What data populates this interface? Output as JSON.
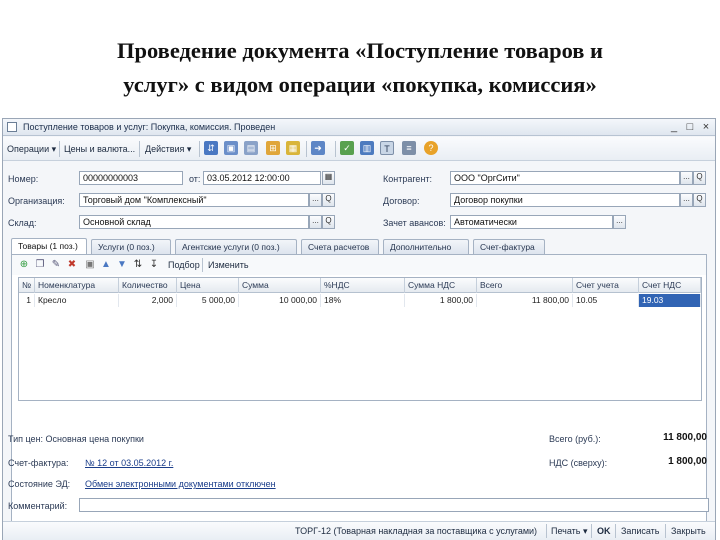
{
  "slide": {
    "title_line1": "Проведение документа «Поступление товаров и",
    "title_line2": "услуг» с видом операции «покупка, комиссия»"
  },
  "window": {
    "title": "Поступление товаров и услуг: Покупка, комиссия. Проведен",
    "controls": [
      "_",
      "□",
      "×"
    ]
  },
  "toolbar": {
    "operations": "Операции ▾",
    "prices_currency": "Цены и валюта...",
    "actions": "Действия ▾",
    "help_icon": "?"
  },
  "header": {
    "number_label": "Номер:",
    "number_value": "00000000003",
    "date_label": "от:",
    "date_value": "03.05.2012 12:00:00",
    "org_label": "Организация:",
    "org_value": "Торговый дом \"Комплексный\"",
    "warehouse_label": "Склад:",
    "warehouse_value": "Основной склад",
    "counterparty_label": "Контрагент:",
    "counterparty_value": "ООО \"ОргСити\"",
    "contract_label": "Договор:",
    "contract_value": "Договор покупки",
    "advance_label": "Зачет авансов:",
    "advance_value": "Автоматически",
    "ellipsis": "...",
    "search_q": "Q"
  },
  "tabs": [
    "Товары (1 поз.)",
    "Услуги (0 поз.)",
    "Агентские услуги (0 поз.)",
    "Счета расчетов",
    "Дополнительно",
    "Счет-фактура"
  ],
  "grid_toolbar": {
    "selection": "Подбор",
    "change": "Изменить"
  },
  "grid": {
    "columns": [
      "№",
      "Номенклатура",
      "Количество",
      "Цена",
      "Сумма",
      "%НДС",
      "Сумма НДС",
      "Всего",
      "Счет учета",
      "Счет НДС"
    ],
    "rows": [
      [
        "1",
        "Кресло",
        "2,000",
        "5 000,00",
        "10 000,00",
        "18%",
        "1 800,00",
        "11 800,00",
        "10.05",
        "19.03"
      ]
    ]
  },
  "footer": {
    "price_type": "Тип цен: Основная цена покупки",
    "invoice_label": "Счет-фактура:",
    "invoice_value": "№ 12 от 03.05.2012 г.",
    "ed_state_label": "Состояние ЭД:",
    "ed_state_value": "Обмен электронными документами отключен",
    "comment_label": "Комментарий:",
    "total_label": "Всего (руб.):",
    "total_value": "11 800,00",
    "vat_label": "НДС (сверху):",
    "vat_value": "1 800,00"
  },
  "bottom": {
    "torg12": "ТОРГ-12 (Товарная накладная за поставщика с услугами)",
    "print": "Печать ▾",
    "ok": "OK",
    "save": "Записать",
    "close": "Закрыть"
  }
}
